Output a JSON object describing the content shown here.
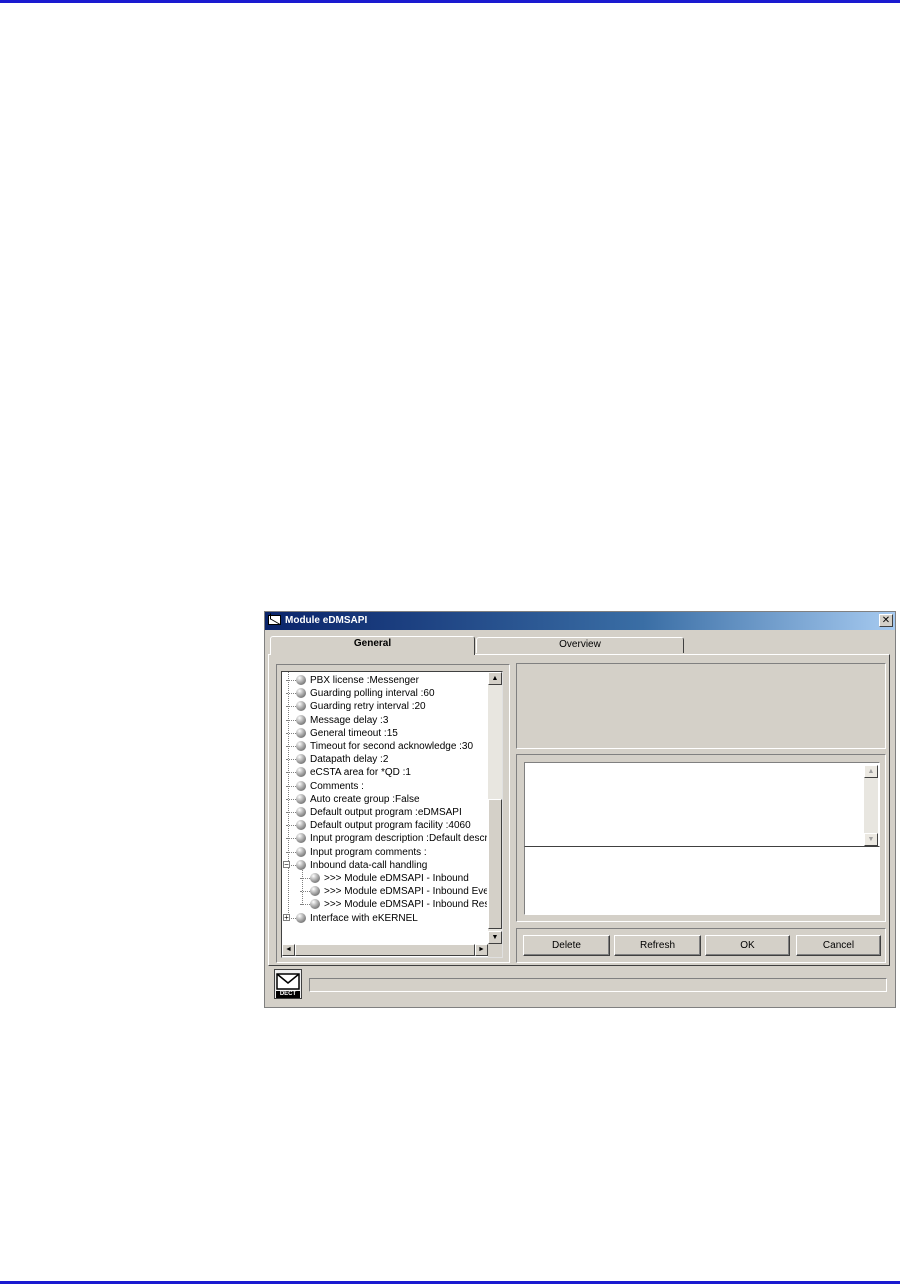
{
  "window": {
    "title": "Module eDMSAPI",
    "close_label": "✕"
  },
  "tabs": [
    {
      "label": "General",
      "active": true
    },
    {
      "label": "Overview",
      "active": false
    }
  ],
  "tree": {
    "items": [
      {
        "label": "PBX license :Messenger",
        "level": 0,
        "expander": ""
      },
      {
        "label": "Guarding polling interval :60",
        "level": 0,
        "expander": ""
      },
      {
        "label": "Guarding retry interval :20",
        "level": 0,
        "expander": ""
      },
      {
        "label": "Message delay :3",
        "level": 0,
        "expander": ""
      },
      {
        "label": "General timeout :15",
        "level": 0,
        "expander": ""
      },
      {
        "label": "Timeout for second acknowledge :30",
        "level": 0,
        "expander": ""
      },
      {
        "label": "Datapath delay :2",
        "level": 0,
        "expander": ""
      },
      {
        "label": "eCSTA area for *QD :1",
        "level": 0,
        "expander": ""
      },
      {
        "label": "Comments :",
        "level": 0,
        "expander": ""
      },
      {
        "label": "Auto create group :False",
        "level": 0,
        "expander": ""
      },
      {
        "label": "Default output program :eDMSAPI",
        "level": 0,
        "expander": ""
      },
      {
        "label": "Default output program facility :4060",
        "level": 0,
        "expander": ""
      },
      {
        "label": "Input program description :Default description",
        "level": 0,
        "expander": ""
      },
      {
        "label": "Input program comments :",
        "level": 0,
        "expander": ""
      },
      {
        "label": "Inbound data-call handling",
        "level": 0,
        "expander": "−"
      },
      {
        "label": ">>> Module eDMSAPI - Inbound",
        "level": 1,
        "expander": ""
      },
      {
        "label": ">>> Module eDMSAPI - Inbound Event",
        "level": 1,
        "expander": ""
      },
      {
        "label": ">>> Module eDMSAPI - Inbound Result",
        "level": 1,
        "expander": ""
      },
      {
        "label": "Interface with eKERNEL",
        "level": 0,
        "expander": "+"
      }
    ]
  },
  "buttons": {
    "delete": "Delete",
    "refresh": "Refresh",
    "ok": "OK",
    "cancel": "Cancel"
  },
  "scroll_arrows": {
    "up": "▲",
    "down": "▼",
    "left": "◄",
    "right": "►"
  },
  "status_icon_text": "DECT"
}
